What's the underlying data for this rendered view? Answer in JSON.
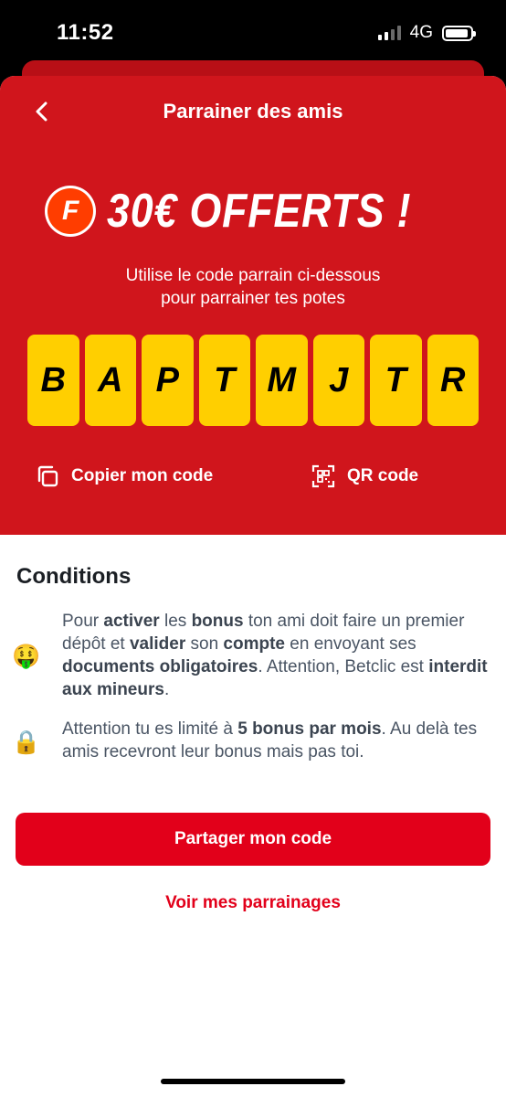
{
  "status": {
    "time": "11:52",
    "network": "4G"
  },
  "header": {
    "title": "Parrainer des amis"
  },
  "offer": {
    "logo_letter": "F",
    "text": "30€ OFFERTS !"
  },
  "subtitle": {
    "line1": "Utilise le code parrain ci-dessous",
    "line2": "pour parrainer tes potes"
  },
  "code": [
    "B",
    "A",
    "P",
    "T",
    "M",
    "J",
    "T",
    "R"
  ],
  "actions": {
    "copy_label": "Copier mon code",
    "qr_label": "QR code"
  },
  "conditions": {
    "title": "Conditions",
    "items": [
      {
        "emoji": "🤑",
        "text_html": "Pour <b>activer</b> les <b>bonus</b> ton ami doit faire un premier dépôt et <b>valider</b> son <b>compte</b> en envoyant ses <b>documents obligatoires</b>. Attention, Betclic est <b>interdit aux mineurs</b>."
      },
      {
        "emoji": "🔒",
        "text_html": "Attention tu es limité à <b>5 bonus par mois</b>. Au delà tes amis recevront leur bonus mais pas toi."
      }
    ]
  },
  "buttons": {
    "share_label": "Partager mon code",
    "view_referrals_label": "Voir mes parrainages"
  },
  "colors": {
    "hero_red": "#d0151c",
    "primary_red": "#e2001a",
    "code_yellow": "#ffcf00",
    "logo_orange": "#ff3d00"
  }
}
